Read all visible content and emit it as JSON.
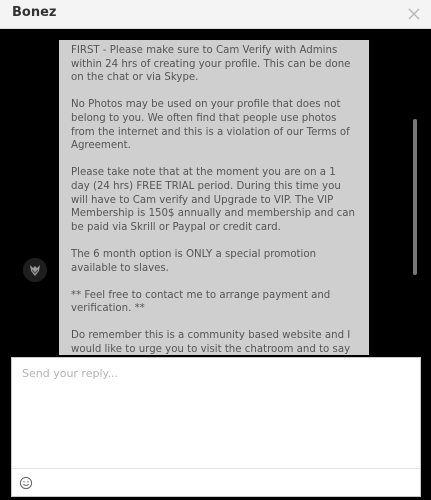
{
  "window": {
    "title": "Bonez",
    "close_icon": "close-icon"
  },
  "message": {
    "paragraphs": [
      "FIRST - Please make sure to Cam Verify with Admins within 24 hrs of creating your profile. This can be done on the chat or via Skype.",
      "No Photos may be used on your profile that does not belong to you. We often find that people use photos from the internet and this is a violation of our Terms of Agreement.",
      "Please take note that at the moment you are on a 1 day (24 hrs) FREE TRIAL period. During this time you will have to Cam verify and Upgrade to VIP. The VIP Membership is 150$ annually and membership and can be paid via Skrill or Paypal or credit card.",
      "The 6 month option is ONLY a special promotion available to slaves.",
      "** Feel free to contact me to arrange payment and verification. **",
      "Do remember this is a community based website and I would like to urge you to visit the chatroom and to say Hi and meet slaves. We found that the interaction on"
    ],
    "avatar_icon": "avatar"
  },
  "composer": {
    "placeholder": "Send your reply...",
    "value": "",
    "emoji_icon": "emoji-icon"
  },
  "colors": {
    "header_bg": "#f4f4f4",
    "chat_bg": "#000000",
    "bubble_bg": "#cfcfcf",
    "bubble_text": "#555555"
  }
}
